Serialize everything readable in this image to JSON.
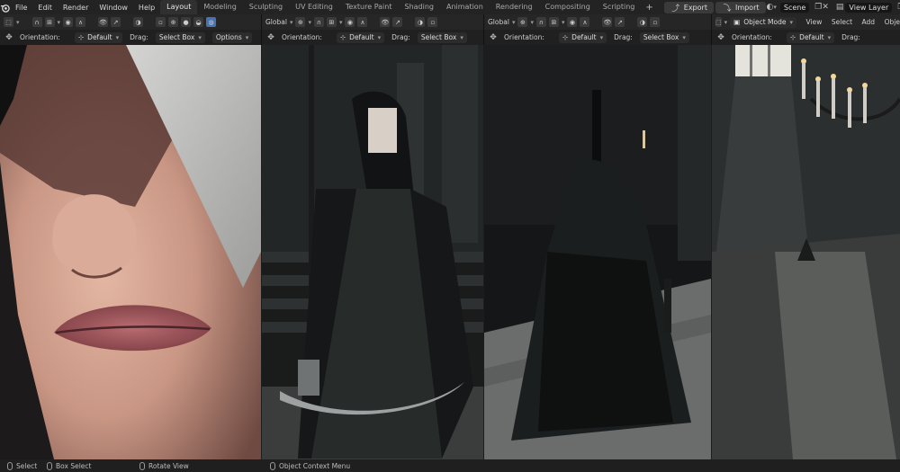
{
  "topbar": {
    "menus": [
      "File",
      "Edit",
      "Render",
      "Window",
      "Help"
    ],
    "tabs": [
      "Layout",
      "Modeling",
      "Sculpting",
      "UV Editing",
      "Texture Paint",
      "Shading",
      "Animation",
      "Rendering",
      "Compositing",
      "Scripting"
    ],
    "active_tab": "Layout",
    "add_tab": "+",
    "export_label": "Export",
    "import_label": "Import",
    "scene_label": "Scene",
    "view_layer_label": "View Layer"
  },
  "viewport1": {
    "orientation_label": "Orientation:",
    "orientation_value": "Default",
    "drag_label": "Drag:",
    "drag_value": "Select Box",
    "options_label": "Options"
  },
  "viewport2": {
    "transform_space": "Global",
    "orientation_label": "Orientation:",
    "orientation_value": "Default",
    "drag_label": "Drag:",
    "drag_value": "Select Box"
  },
  "viewport3": {
    "transform_space": "Global",
    "orientation_label": "Orientation:",
    "orientation_value": "Default",
    "drag_label": "Drag:",
    "drag_value": "Select Box"
  },
  "viewport4": {
    "mode_label": "Object Mode",
    "view_label": "View",
    "select_label": "Select",
    "add_label": "Add",
    "object_label": "Obje",
    "orientation_label": "Orientation:",
    "orientation_value": "Default",
    "drag_label": "Drag:"
  },
  "statusbar": {
    "select": "Select",
    "box_select": "Box Select",
    "rotate_view": "Rotate View",
    "context_menu": "Object Context Menu"
  },
  "colors": {
    "accent_blue": "#4772b3",
    "active_tab": "#303030",
    "background": "#1d1d1d"
  }
}
